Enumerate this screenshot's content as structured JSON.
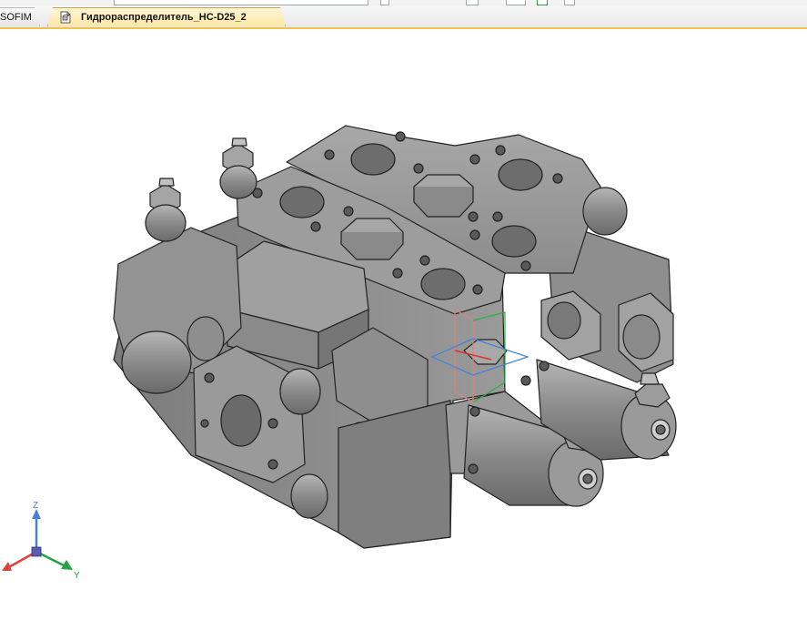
{
  "tabs": [
    {
      "label": "SOFIM",
      "active": false
    },
    {
      "label": "Гидрораспределитель_HC-D25_2",
      "active": true
    }
  ],
  "triad": {
    "z": "Z",
    "y": "Y"
  },
  "colors": {
    "tab_active_bg": "#ffe7a4",
    "tab_border": "#c8a24a",
    "axis_x": "#e03030",
    "axis_y": "#20a040",
    "axis_z": "#4080e0",
    "model_gray": "#8f8f8f"
  },
  "icons": {
    "document": "document-icon"
  }
}
